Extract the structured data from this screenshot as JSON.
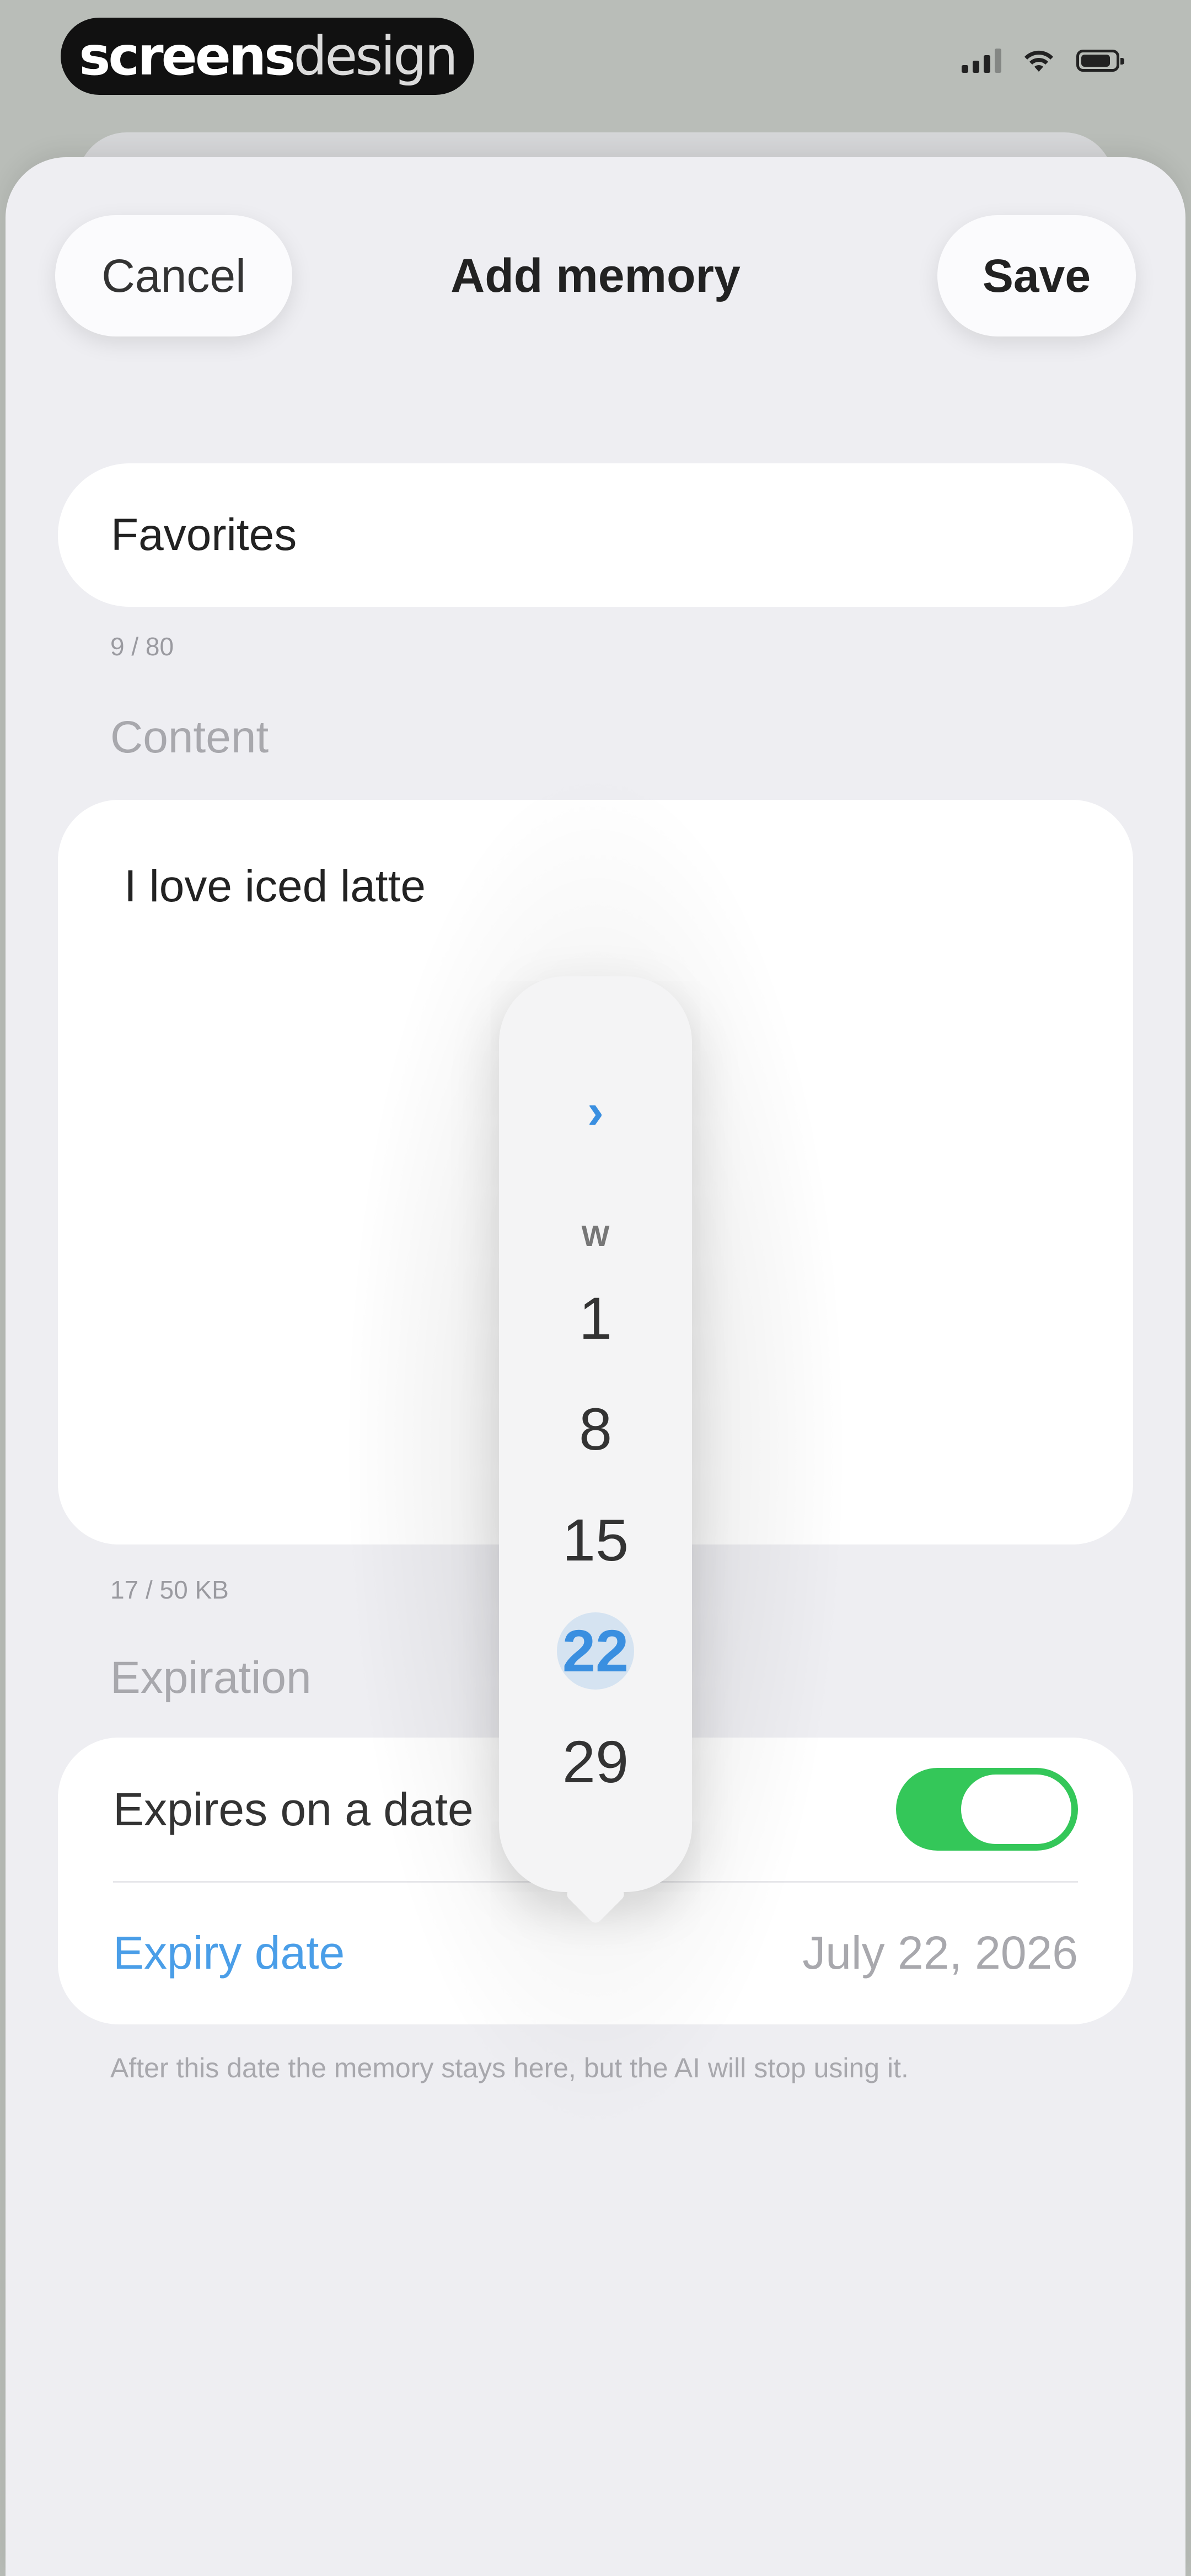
{
  "status_bar": {
    "brand_bold": "screens",
    "brand_light": "design",
    "icons": [
      "signal-icon",
      "wifi-icon",
      "battery-icon"
    ]
  },
  "header": {
    "cancel_label": "Cancel",
    "title": "Add memory",
    "save_label": "Save"
  },
  "name_field": {
    "value": "Favorites",
    "counter": "9 / 80"
  },
  "content": {
    "label": "Content",
    "value": "I love iced latte",
    "counter": "17 / 50 KB"
  },
  "expiration": {
    "label": "Expiration",
    "toggle_label": "Expires on a date",
    "toggle_on": true,
    "expiry_label": "Expiry date",
    "expiry_value": "July 22, 2026",
    "footnote": "After this date the memory stays here, but the AI will stop using it."
  },
  "day_picker": {
    "chevron": "›",
    "weekday": "W",
    "days": [
      "1",
      "8",
      "15",
      "22",
      "29"
    ],
    "selected": "22"
  },
  "colors": {
    "accent": "#3a8fe0",
    "toggle_on": "#34c759",
    "sheet_bg": "#eeeef2"
  }
}
